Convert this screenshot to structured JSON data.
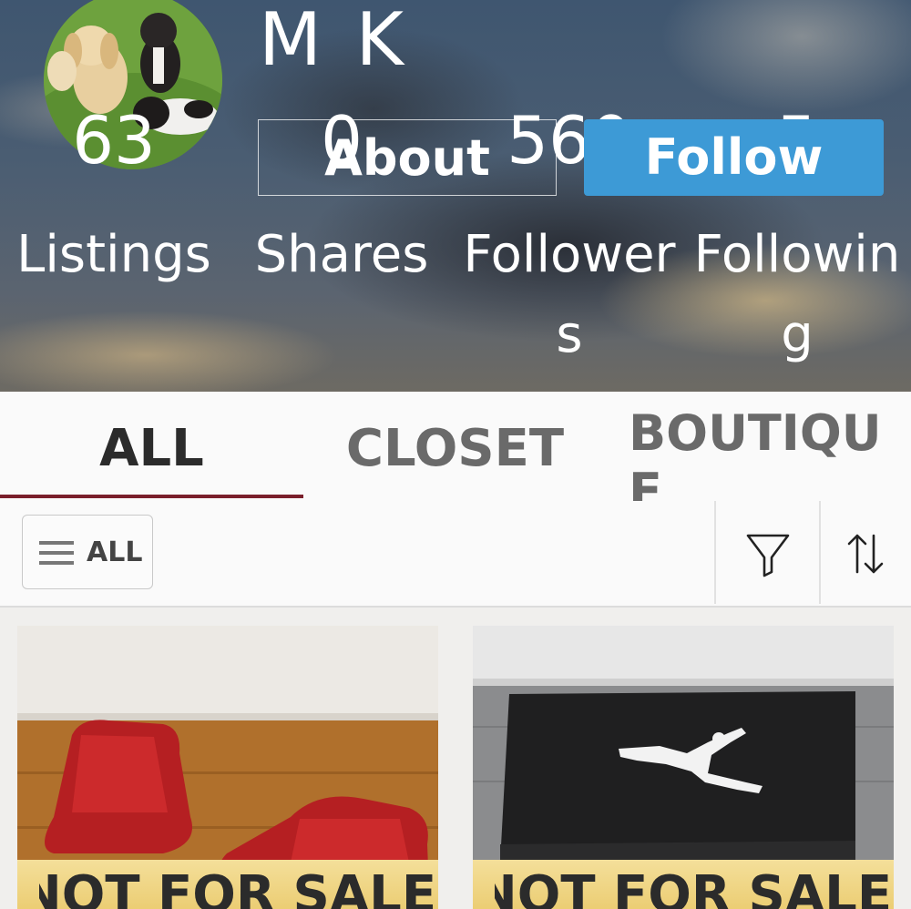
{
  "profile": {
    "name": "M K",
    "about_label": "About",
    "follow_label": "Follow",
    "stats": [
      {
        "value": "63",
        "label": "Listings"
      },
      {
        "value": "0",
        "label": "Shares"
      },
      {
        "value": "560",
        "label": "Followers"
      },
      {
        "value": "5",
        "label": "Following"
      }
    ]
  },
  "tabs": [
    {
      "label": "ALL",
      "active": true
    },
    {
      "label": "CLOSET",
      "active": false
    },
    {
      "label": "BOUTIQUE",
      "active": false
    }
  ],
  "filterbar": {
    "category_label": "ALL",
    "filter_icon": "filter-funnel-icon",
    "sort_icon": "sort-arrows-icon"
  },
  "listings": [
    {
      "badge": "NOT FOR SALE",
      "image": "red-boots-photo"
    },
    {
      "badge": "NOT FOR SALE",
      "image": "jordan-shoebox-photo"
    }
  ],
  "colors": {
    "follow_button": "#3d9ad6",
    "tab_indicator": "#7a1f2b",
    "badge": "#efd47f"
  }
}
